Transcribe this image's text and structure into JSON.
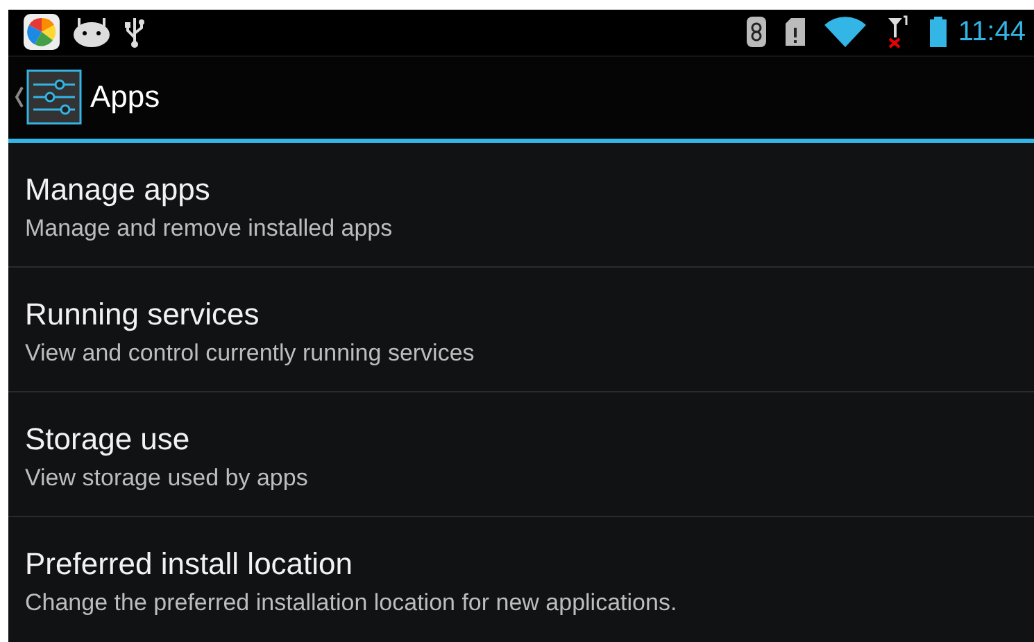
{
  "status_bar": {
    "time": "11:44"
  },
  "action_bar": {
    "title": "Apps"
  },
  "items": [
    {
      "title": "Manage apps",
      "summary": "Manage and remove installed apps"
    },
    {
      "title": "Running services",
      "summary": "View and control currently running services"
    },
    {
      "title": "Storage use",
      "summary": "View storage used by apps"
    },
    {
      "title": "Preferred install location",
      "summary": "Change the preferred installation location for new applications."
    }
  ]
}
